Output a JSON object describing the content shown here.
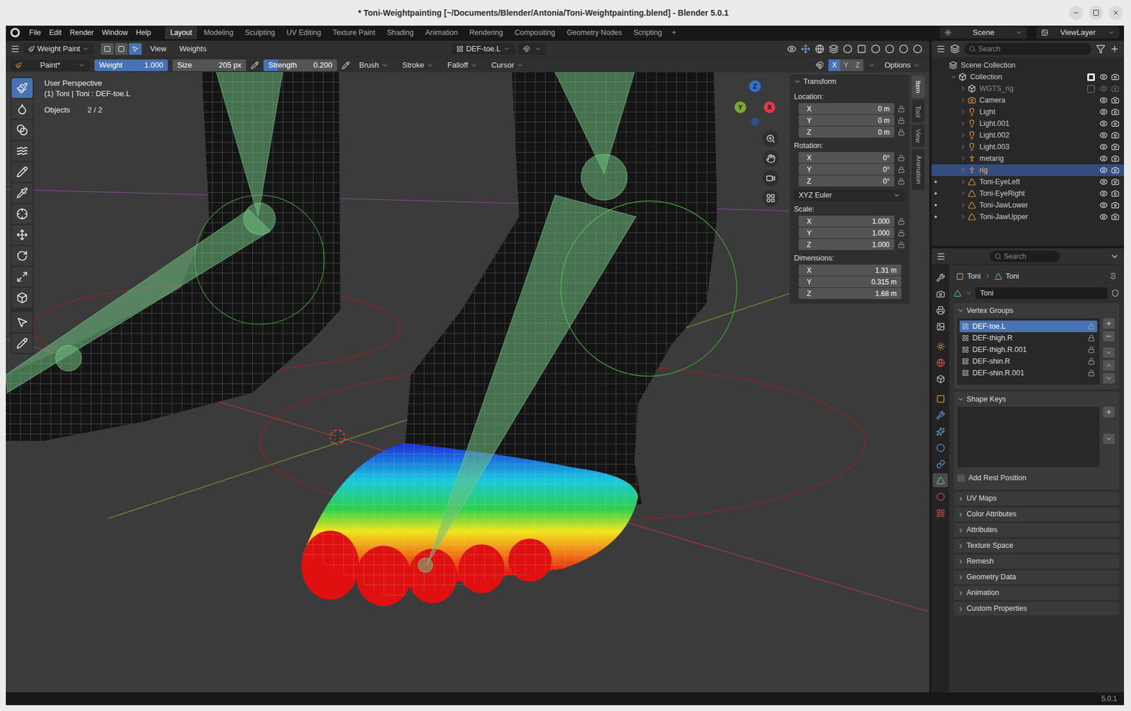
{
  "window": {
    "title": "* Toni-Weightpainting [~/Documents/Blender/Antonia/Toni-Weightpainting.blend] - Blender 5.0.1"
  },
  "menu": [
    "File",
    "Edit",
    "Render",
    "Window",
    "Help"
  ],
  "workspaces": [
    {
      "label": "Layout",
      "selected": true
    },
    {
      "label": "Modeling",
      "selected": false
    },
    {
      "label": "Sculpting",
      "selected": false
    },
    {
      "label": "UV Editing",
      "selected": false
    },
    {
      "label": "Texture Paint",
      "selected": false
    },
    {
      "label": "Shading",
      "selected": false
    },
    {
      "label": "Animation",
      "selected": false
    },
    {
      "label": "Rendering",
      "selected": false
    },
    {
      "label": "Compositing",
      "selected": false
    },
    {
      "label": "Geometry Nodes",
      "selected": false
    },
    {
      "label": "Scripting",
      "selected": false
    }
  ],
  "workspace_add": "+",
  "scene": "Scene",
  "view_layer": "ViewLayer",
  "viewport_header": {
    "mode": "Weight Paint",
    "menus": [
      "View",
      "Weights"
    ],
    "vertex_group": "DEF-toe.L"
  },
  "tool_settings": {
    "brush": "Paint*",
    "fields": [
      {
        "label": "Weight",
        "value": "1.000",
        "level": 1
      },
      {
        "label": "Size",
        "value": "205 px",
        "level": 0
      },
      {
        "label": "Strength",
        "value": "0.200",
        "level": 0.2
      }
    ],
    "menus": [
      "Brush",
      "Stroke",
      "Falloff",
      "Cursor"
    ],
    "mirror_axes": [
      {
        "label": "X",
        "on": true
      },
      {
        "label": "Y",
        "on": false
      },
      {
        "label": "Z",
        "on": false
      }
    ],
    "options": "Options"
  },
  "tools": [
    {
      "kind": "draw",
      "selected": true
    },
    {
      "kind": "blur",
      "selected": false
    },
    {
      "kind": "average",
      "selected": false
    },
    {
      "kind": "smear",
      "selected": false
    },
    {
      "kind": "gradient",
      "selected": false
    },
    {
      "kind": "sample",
      "selected": false
    },
    {
      "kind": "cursor",
      "selected": false
    },
    {
      "kind": "move",
      "selected": false
    },
    {
      "kind": "rotate",
      "selected": false
    },
    {
      "kind": "scale",
      "selected": false
    },
    {
      "kind": "transform",
      "selected": false
    },
    {
      "kind": "select",
      "selected": false
    },
    {
      "kind": "annotate",
      "selected": false
    }
  ],
  "viewport": {
    "perspective": "User Perspective",
    "object_info": "(1) Toni | Toni : DEF-toe.L",
    "stats": [
      {
        "label": "Objects",
        "value": "2 / 2"
      }
    ],
    "gizmo_axes": [
      {
        "label": "Z",
        "color": "#2f6fd6"
      },
      {
        "label": "X",
        "color": "#d93a4a"
      },
      {
        "label": "Y",
        "color": "#7aa82e"
      }
    ]
  },
  "sidebar": {
    "tabs": [
      {
        "label": "Item",
        "selected": true
      },
      {
        "label": "Tool",
        "selected": false
      },
      {
        "label": "View",
        "selected": false
      },
      {
        "label": "Animation",
        "selected": false
      }
    ],
    "panel": "Transform",
    "groups": [
      {
        "label": "Location:",
        "locks": true,
        "rows": [
          {
            "axis": "X",
            "value": "0 m"
          },
          {
            "axis": "Y",
            "value": "0 m"
          },
          {
            "axis": "Z",
            "value": "0 m"
          }
        ]
      },
      {
        "label": "Rotation:",
        "locks": true,
        "rows": [
          {
            "axis": "X",
            "value": "0°"
          },
          {
            "axis": "Y",
            "value": "0°"
          },
          {
            "axis": "Z",
            "value": "0°"
          }
        ],
        "mode": "XYZ Euler"
      },
      {
        "label": "Scale:",
        "locks": true,
        "rows": [
          {
            "axis": "X",
            "value": "1.000"
          },
          {
            "axis": "Y",
            "value": "1.000"
          },
          {
            "axis": "Z",
            "value": "1.000"
          }
        ]
      },
      {
        "label": "Dimensions:",
        "locks": false,
        "rows": [
          {
            "axis": "X",
            "value": "1.31 m"
          },
          {
            "axis": "Y",
            "value": "0.315 m"
          },
          {
            "axis": "Z",
            "value": "1.68 m"
          }
        ]
      }
    ]
  },
  "outliner": {
    "search": "Search",
    "items": [
      {
        "name": "Scene Collection",
        "kind": "scene",
        "depth": 0,
        "expanded": true,
        "selected": false,
        "in_mode": false,
        "visible": true
      },
      {
        "name": "Collection",
        "kind": "collection",
        "depth": 1,
        "expanded": true,
        "checked": true,
        "selected": false,
        "in_mode": false,
        "visible": true
      },
      {
        "name": "WGTS_rig",
        "kind": "collection",
        "depth": 2,
        "expanded": false,
        "checked": false,
        "selected": false,
        "in_mode": false,
        "visible": false
      },
      {
        "name": "Camera",
        "kind": "camera",
        "depth": 2,
        "expanded": false,
        "selected": false,
        "in_mode": false,
        "visible": true
      },
      {
        "name": "Light",
        "kind": "light",
        "depth": 2,
        "expanded": false,
        "selected": false,
        "in_mode": false,
        "visible": true
      },
      {
        "name": "Light.001",
        "kind": "light",
        "depth": 2,
        "expanded": false,
        "selected": false,
        "in_mode": false,
        "visible": true
      },
      {
        "name": "Light.002",
        "kind": "light",
        "depth": 2,
        "expanded": false,
        "selected": false,
        "in_mode": false,
        "visible": true
      },
      {
        "name": "Light.003",
        "kind": "light",
        "depth": 2,
        "expanded": false,
        "selected": false,
        "in_mode": false,
        "visible": true
      },
      {
        "name": "metarig",
        "kind": "armature",
        "depth": 2,
        "expanded": false,
        "selected": false,
        "in_mode": false,
        "visible": true
      },
      {
        "name": "rig",
        "kind": "armature",
        "depth": 2,
        "expanded": false,
        "selected": true,
        "in_mode": false,
        "visible": true
      },
      {
        "name": "Toni-EyeLeft",
        "kind": "mesh",
        "depth": 2,
        "expanded": false,
        "selected": false,
        "in_mode": true,
        "visible": true
      },
      {
        "name": "Toni-EyeRight",
        "kind": "mesh",
        "depth": 2,
        "expanded": false,
        "selected": false,
        "in_mode": true,
        "visible": true
      },
      {
        "name": "Toni-JawLower",
        "kind": "mesh",
        "depth": 2,
        "expanded": false,
        "selected": false,
        "in_mode": true,
        "visible": true
      },
      {
        "name": "Toni-JawUpper",
        "kind": "mesh",
        "depth": 2,
        "expanded": false,
        "selected": false,
        "in_mode": true,
        "visible": true
      }
    ]
  },
  "properties": {
    "search": "Search",
    "tabs": [
      {
        "kind": "tool",
        "selected": false
      },
      {
        "kind": "render",
        "selected": false
      },
      {
        "kind": "output",
        "selected": false
      },
      {
        "kind": "view_layer",
        "selected": false
      },
      {
        "kind": "scene",
        "selected": false
      },
      {
        "kind": "world",
        "selected": false
      },
      {
        "kind": "collection",
        "selected": false
      },
      {
        "kind": "object",
        "selected": false
      },
      {
        "kind": "modifiers",
        "selected": false
      },
      {
        "kind": "particles",
        "selected": false
      },
      {
        "kind": "physics",
        "selected": false
      },
      {
        "kind": "constraints",
        "selected": false
      },
      {
        "kind": "data",
        "selected": true
      },
      {
        "kind": "material",
        "selected": false
      },
      {
        "kind": "texture",
        "selected": false
      }
    ],
    "breadcrumb": [
      "Toni",
      "Toni"
    ],
    "data_name": "Toni",
    "vertex_groups": {
      "title": "Vertex Groups",
      "items": [
        {
          "name": "DEF-toe.L",
          "selected": true
        },
        {
          "name": "DEF-thigh.R",
          "selected": false
        },
        {
          "name": "DEF-thigh.R.001",
          "selected": false
        },
        {
          "name": "DEF-shin.R",
          "selected": false
        },
        {
          "name": "DEF-shin.R.001",
          "selected": false
        }
      ]
    },
    "shape_keys": {
      "title": "Shape Keys"
    },
    "add_rest_position": {
      "label": "Add Rest Position",
      "checked": false
    },
    "collapsed_panels": [
      "UV Maps",
      "Color Attributes",
      "Attributes",
      "Texture Space",
      "Remesh",
      "Geometry Data",
      "Animation",
      "Custom Properties"
    ]
  },
  "status_bar": {
    "version": "5.0.1"
  }
}
